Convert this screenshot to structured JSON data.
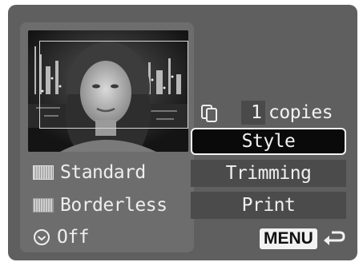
{
  "left_panel": {
    "options": [
      {
        "label": "Standard",
        "icon": "paper-standard-icon"
      },
      {
        "label": "Borderless",
        "icon": "paper-borderless-icon"
      }
    ],
    "date": {
      "label": "Off",
      "icon": "clock-icon"
    }
  },
  "copies": {
    "count": "1",
    "label": "copies",
    "icon": "copies-icon"
  },
  "menu": {
    "items": [
      {
        "label": "Style",
        "selected": true
      },
      {
        "label": "Trimming",
        "selected": false
      },
      {
        "label": "Print",
        "selected": false
      }
    ]
  },
  "footer": {
    "menu_label": "MENU",
    "back_icon": "return-arrow-icon"
  }
}
